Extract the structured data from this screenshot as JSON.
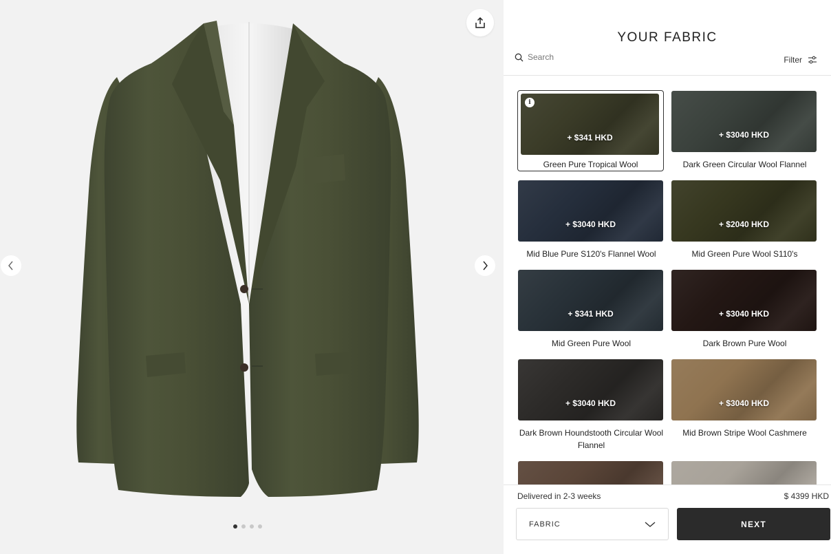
{
  "panel": {
    "title": "YOUR FABRIC",
    "search_placeholder": "Search",
    "filter_label": "Filter"
  },
  "fabrics": [
    {
      "name": "Green Pure Tropical Wool",
      "price": "+ $341 HKD",
      "selected": true,
      "color": "#3b3c28"
    },
    {
      "name": "Dark Green Circular Wool Flannel",
      "price": "+ $3040 HKD",
      "selected": false,
      "color": "#3b423d"
    },
    {
      "name": "Mid Blue Pure S120's Flannel Wool",
      "price": "+ $3040 HKD",
      "selected": false,
      "color": "#252e3c"
    },
    {
      "name": "Mid Green Pure Wool S110's",
      "price": "+ $2040 HKD",
      "selected": false,
      "color": "#36371f"
    },
    {
      "name": "Mid Green Pure Wool",
      "price": "+ $341 HKD",
      "selected": false,
      "color": "#283138"
    },
    {
      "name": "Dark Brown Pure Wool",
      "price": "+ $3040 HKD",
      "selected": false,
      "color": "#231714"
    },
    {
      "name": "Dark Brown Houndstooth Circular Wool Flannel",
      "price": "+ $3040 HKD",
      "selected": false,
      "color": "#2c2a28"
    },
    {
      "name": "Mid Brown Stripe Wool Cashmere",
      "price": "+ $3040 HKD",
      "selected": false,
      "color": "#8f7350"
    },
    {
      "name": "",
      "price": "",
      "selected": false,
      "color": "#5a4538"
    },
    {
      "name": "",
      "price": "",
      "selected": false,
      "color": "#a8a299"
    }
  ],
  "footer": {
    "delivery": "Delivered in 2-3 weeks",
    "total": "$ 4399 HKD",
    "step_select": "FABRIC",
    "next_label": "NEXT"
  },
  "carousel": {
    "total_slides": 4,
    "active_slide": 1
  },
  "icons": {
    "share": "share-icon",
    "prev": "chevron-left-icon",
    "next": "chevron-right-icon",
    "search": "search-icon",
    "filter": "sliders-icon",
    "dropdown": "chevron-down-icon",
    "info": "info-icon"
  },
  "colors": {
    "jacket": "#4a5036",
    "accent_dark": "#2b2b2b",
    "preview_bg": "#f2f2f2"
  }
}
